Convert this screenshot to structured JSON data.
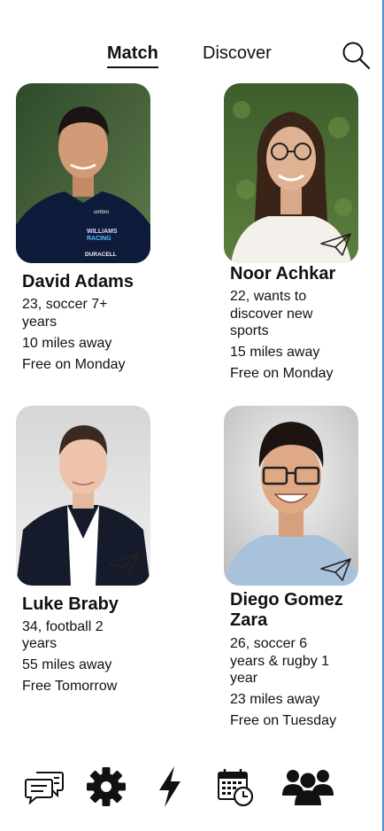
{
  "tabs": {
    "match": "Match",
    "discover": "Discover"
  },
  "cards": [
    {
      "name": "David Adams",
      "lines": [
        "23, soccer 7+",
        "years",
        "10 miles away",
        "Free on Monday"
      ],
      "shirt_text": [
        "WILLIAMS",
        "RACING",
        "DURACELL",
        "umbro"
      ]
    },
    {
      "name": "Noor Achkar",
      "lines": [
        "22, wants to",
        "discover new",
        "sports",
        "15 miles away",
        "Free on Monday"
      ]
    },
    {
      "name": "Luke Braby",
      "lines": [
        "34, football 2",
        "years",
        "55 miles away",
        "Free Tomorrow"
      ]
    },
    {
      "name_lines": [
        "Diego Gomez",
        "Zara"
      ],
      "lines": [
        "26, soccer 6",
        "years & rugby 1",
        "year",
        "23 miles away",
        "Free on Tuesday"
      ]
    }
  ],
  "nav": [
    "chat-icon",
    "gear-icon",
    "lightning-icon",
    "calendar-clock-icon",
    "group-icon"
  ],
  "colors": {
    "accent_edge": "#4a90d9",
    "text": "#111111"
  }
}
